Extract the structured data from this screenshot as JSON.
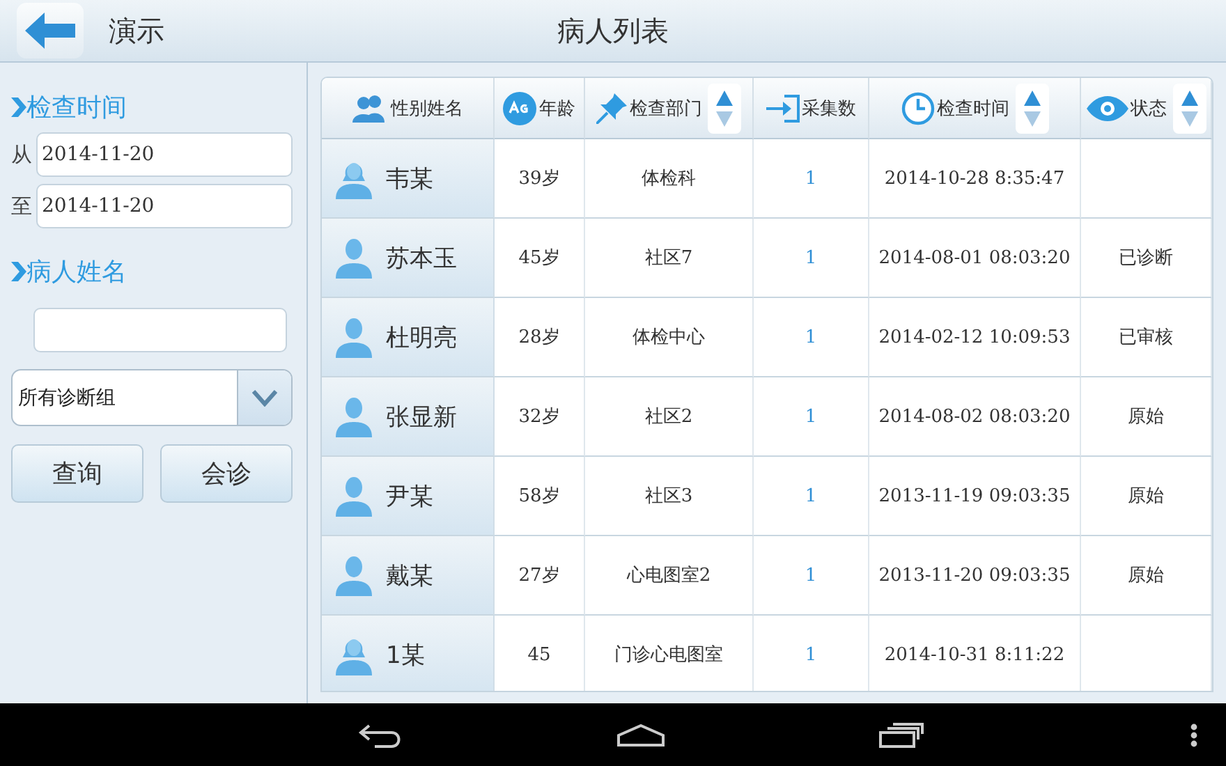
{
  "header": {
    "back_label": "演示",
    "title": "病人列表"
  },
  "sidebar": {
    "date_section": "检查时间",
    "from_label": "从",
    "from_value": "2014-11-20",
    "to_label": "至",
    "to_value": "2014-11-20",
    "name_section": "病人姓名",
    "group_select": "所有诊断组",
    "buttons": [
      "查询",
      "会诊"
    ]
  },
  "table": {
    "columns": [
      {
        "label": "性别姓名",
        "kind": "people",
        "sortable": false
      },
      {
        "label": "年龄",
        "kind": "age",
        "sortable": false
      },
      {
        "label": "检查部门",
        "kind": "pin",
        "sortable": true
      },
      {
        "label": "采集数",
        "kind": "import",
        "sortable": false
      },
      {
        "label": "检查时间",
        "kind": "clock",
        "sortable": true
      },
      {
        "label": "状态",
        "kind": "eye",
        "sortable": true
      }
    ],
    "rows": [
      {
        "kind": "female",
        "name": "韦某",
        "age": "39岁",
        "dept": "体检科",
        "count": "1",
        "time": "2014-10-28 8:35:47",
        "status": ""
      },
      {
        "kind": "male",
        "name": "苏本玉",
        "age": "45岁",
        "dept": "社区7",
        "count": "1",
        "time": "2014-08-01 08:03:20",
        "status": "已诊断"
      },
      {
        "kind": "male",
        "name": "杜明亮",
        "age": "28岁",
        "dept": "体检中心",
        "count": "1",
        "time": "2014-02-12 10:09:53",
        "status": "已审核"
      },
      {
        "kind": "male",
        "name": "张显新",
        "age": "32岁",
        "dept": "社区2",
        "count": "1",
        "time": "2014-08-02 08:03:20",
        "status": "原始"
      },
      {
        "kind": "male",
        "name": "尹某",
        "age": "58岁",
        "dept": "社区3",
        "count": "1",
        "time": "2013-11-19 09:03:35",
        "status": "原始"
      },
      {
        "kind": "male",
        "name": "戴某",
        "age": "27岁",
        "dept": "心电图室2",
        "count": "1",
        "time": "2013-11-20 09:03:35",
        "status": "原始"
      },
      {
        "kind": "female",
        "name": "1某",
        "age": "45",
        "dept": "门诊心电图室",
        "count": "1",
        "time": "2014-10-31 8:11:22",
        "status": ""
      }
    ]
  }
}
